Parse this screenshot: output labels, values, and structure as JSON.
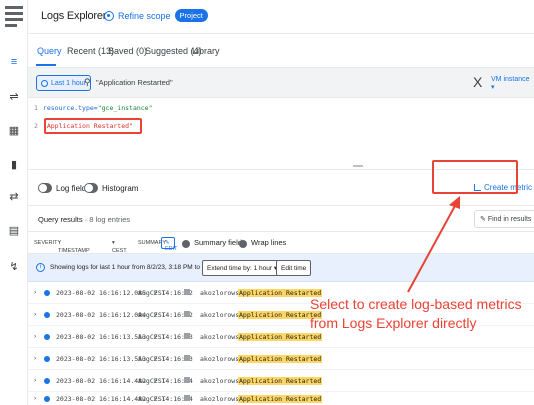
{
  "header": {
    "title": "Logs Explorer",
    "refine_scope": "Refine scope",
    "project_badge": "Project"
  },
  "rail": {
    "icons": [
      "menu-icon",
      "list-icon",
      "query-icon",
      "dashboard-icon",
      "chart-icon",
      "shuffle-icon",
      "storage-icon",
      "router-icon"
    ]
  },
  "tabs": [
    {
      "label": "Query"
    },
    {
      "label": "Recent (13)"
    },
    {
      "label": "Saved (0)"
    },
    {
      "label": "Suggested (4)"
    },
    {
      "label": "Library"
    }
  ],
  "querybar": {
    "time_range": "Last 1 hour",
    "query": "\"Application Restarted\"",
    "resource_chip": "VM instance"
  },
  "editor": {
    "line1_no": "1",
    "line1_key": "resource.type=",
    "line1_val": "\"gce_instance\"",
    "line2_no": "2",
    "line2_val": "\"Application Restarted\""
  },
  "fields": {
    "log_fields": "Log fields",
    "histogram": "Histogram",
    "create_metric": "Create metric"
  },
  "results": {
    "title": "Query results",
    "count": "8 log entries",
    "find": "Find in results"
  },
  "columns": {
    "severity": "SEVERITY",
    "timestamp": "TIMESTAMP",
    "timezone": "CEST",
    "summary": "SUMMARY",
    "edit": "EDIT",
    "summary_fields": "Summary fields",
    "wrap_lines": "Wrap lines"
  },
  "info": {
    "text": "Showing logs for last 1 hour from 8/2/23, 3:18 PM to 8/2/23, 4:18 PM.",
    "extend": "Extend time by: 1 hour",
    "edit_time": "Edit time"
  },
  "rows": [
    {
      "ts": "2023-08-02 16:16:12.085 CEST",
      "summary_time": "Aug  2 14:16:12",
      "user": "akozlorowska:",
      "msg": "Application Restarted"
    },
    {
      "ts": "2023-08-02 16:16:12.094 CEST",
      "summary_time": "Aug  2 14:16:12",
      "user": "akozlorowska:",
      "msg": "Application Restarted"
    },
    {
      "ts": "2023-08-02 16:16:13.553 CEST",
      "summary_time": "Aug  2 14:16:13",
      "user": "akozlorowska:",
      "msg": "Application Restarted"
    },
    {
      "ts": "2023-08-02 16:16:13.553 CEST",
      "summary_time": "Aug  2 14:16:13",
      "user": "akozlorowska:",
      "msg": "Application Restarted"
    },
    {
      "ts": "2023-08-02 16:16:14.482 CEST",
      "summary_time": "Aug  2 14:16:14",
      "user": "akozlorowska:",
      "msg": "Application Restarted"
    },
    {
      "ts": "2023-08-02 16:16:14.482 CEST",
      "summary_time": "Aug  2 14:16:14",
      "user": "akozlorowska:",
      "msg": "Application Restarted"
    }
  ],
  "callout": {
    "line1": "Select to create log-based metrics",
    "line2": "from Logs Explorer directly"
  },
  "colors": {
    "accent": "#1a73e8",
    "annotation": "#ea4335",
    "highlight": "#fdd663"
  }
}
